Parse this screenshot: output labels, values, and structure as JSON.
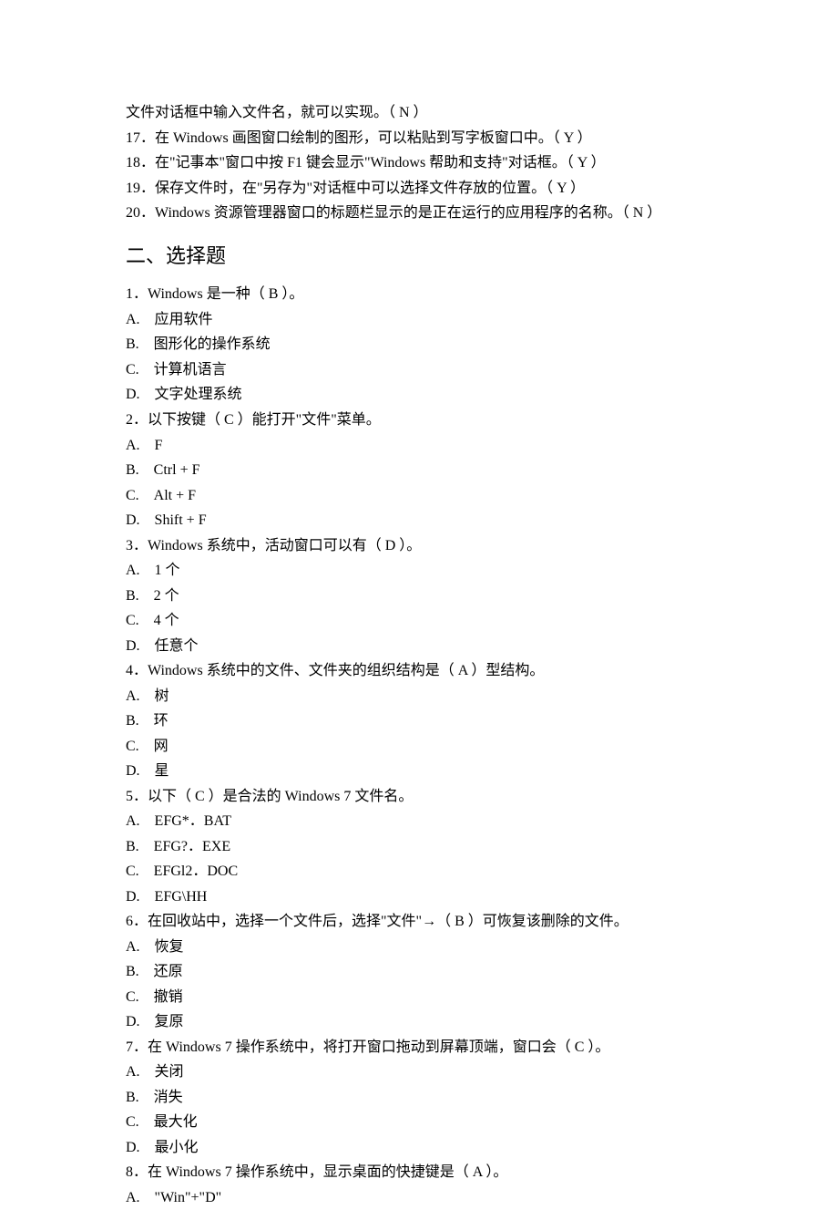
{
  "tf_items": [
    "文件对话框中输入文件名，就可以实现。（ N ）",
    "17．在 Windows 画图窗口绘制的图形，可以粘贴到写字板窗口中。（ Y  ）",
    "18．在\"记事本\"窗口中按 F1 键会显示\"Windows 帮助和支持\"对话框。（ Y ）",
    "19．保存文件时，在\"另存为\"对话框中可以选择文件存放的位置。（ Y ）",
    "20．Windows 资源管理器窗口的标题栏显示的是正在运行的应用程序的名称。（ N ）"
  ],
  "section_heading": "二、选择题",
  "mc": [
    {
      "stem": "1．Windows 是一种（ B   ）。",
      "opts": [
        "A.　应用软件",
        "B.　图形化的操作系统",
        "C.　计算机语言",
        "D.　文字处理系统"
      ]
    },
    {
      "stem": "2．以下按键（ C   ）能打开\"文件\"菜单。",
      "opts": [
        "A.　F",
        "B.　Ctrl + F",
        "C.　Alt + F",
        "D.　Shift + F"
      ]
    },
    {
      "stem": "3．Windows  系统中，活动窗口可以有（ D   ）。",
      "opts": [
        "A.　1 个",
        "B.　2 个",
        "C.　4 个",
        "D.　任意个"
      ]
    },
    {
      "stem": "4．Windows  系统中的文件、文件夹的组织结构是（ A    ）型结构。",
      "opts": [
        "A.　树",
        "B.　环",
        "C.　网",
        "D.　星"
      ]
    },
    {
      "stem": "5．以下（  C   ）是合法的 Windows 7 文件名。",
      "opts": [
        "A.　EFG*．BAT",
        "B.　EFG?．EXE",
        "C.　EFGl2．DOC",
        "D.　EFG\\HH"
      ]
    },
    {
      "stem": "6．在回收站中，选择一个文件后，选择\"文件\"→（  B   ）可恢复该删除的文件。",
      "opts": [
        "A.　恢复",
        "B.　还原",
        "C.　撤销",
        "D.　复原"
      ]
    },
    {
      "stem": "7．在 Windows 7 操作系统中，将打开窗口拖动到屏幕顶端，窗口会（ C    ）。",
      "opts": [
        "A.　关闭",
        "B.　消失",
        "C.　最大化",
        "D.　最小化"
      ]
    },
    {
      "stem": "8．在 Windows 7 操作系统中，显示桌面的快捷键是（  A   ）。",
      "opts": [
        "A.　\"Win\"+\"D\""
      ]
    }
  ]
}
